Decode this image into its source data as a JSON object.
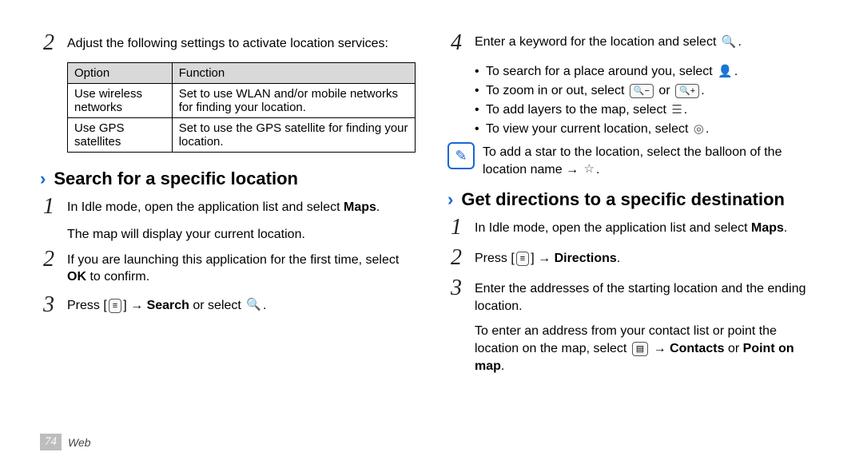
{
  "left": {
    "step2": "Adjust the following settings to activate location services:",
    "table": {
      "h1": "Option",
      "h2": "Function",
      "r1c1": "Use wireless networks",
      "r1c2": "Set to use WLAN and/or mobile networks for finding your location.",
      "r2c1": "Use GPS satellites",
      "r2c2": "Set to use the GPS satellite for finding your location."
    },
    "sec_title": "Search for a specific location",
    "s1a": "In Idle mode, open the application list and select ",
    "s1b": "Maps",
    "s1c": ".",
    "s1_sub": "The map will display your current location.",
    "s2a": "If you are launching this application for the first time, select ",
    "s2b": "OK",
    "s2c": " to confirm.",
    "s3a": "Press [",
    "s3b": "] → ",
    "s3c": "Search",
    "s3d": " or select ",
    "s3e": "."
  },
  "right": {
    "s4": "Enter a keyword for the location and select ",
    "b1": "To search for a place around you, select ",
    "b2a": "To zoom in or out, select ",
    "b2b": " or ",
    "b3": "To add layers to the map, select ",
    "b4": "To view your current location, select ",
    "note_a": "To add a star to the location, select the balloon of the location name → ",
    "sec_title": "Get directions to a specific destination",
    "d1a": "In Idle mode, open the application list and select ",
    "d1b": "Maps",
    "d2a": "Press [",
    "d2b": "] → ",
    "d2c": "Directions",
    "d3": "Enter the addresses of the starting location and the ending location.",
    "d3_sub_a": "To enter an address from your contact list or point the location on the map, select ",
    "d3_sub_b": " → ",
    "d3_sub_c": "Contacts",
    "d3_sub_d": " or ",
    "d3_sub_e": "Point on map",
    "d3_sub_f": "."
  },
  "footer": {
    "page": "74",
    "cat": "Web"
  },
  "nums": {
    "n1": "1",
    "n2": "2",
    "n3": "3",
    "n4": "4"
  },
  "dot": "."
}
